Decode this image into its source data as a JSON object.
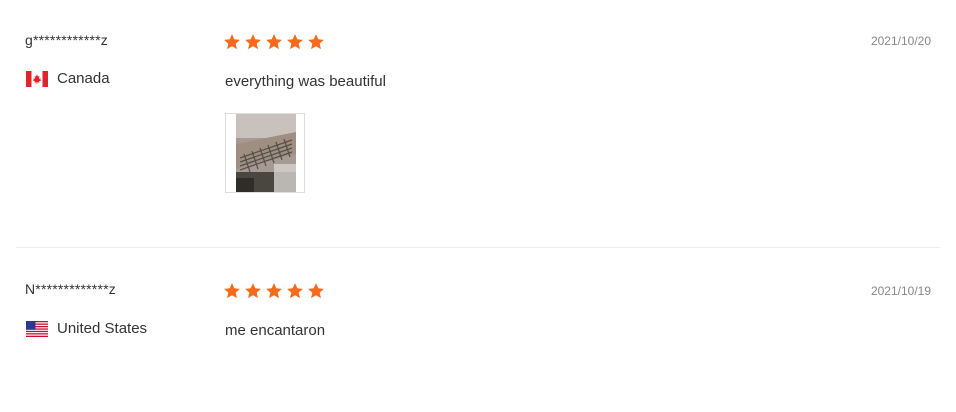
{
  "colors": {
    "star": "#f56a1b",
    "text": "#333333",
    "date": "#888888",
    "divider": "#eeeeee"
  },
  "reviews": [
    {
      "user": "g************z",
      "country": "Canada",
      "flag_icon": "canada-flag-icon",
      "rating": 5,
      "date": "2021/10/20",
      "comment": "everything was beautiful",
      "has_photo": true
    },
    {
      "user": "N*************z",
      "country": "United States",
      "flag_icon": "us-flag-icon",
      "rating": 5,
      "date": "2021/10/19",
      "comment": "me encantaron",
      "has_photo": false
    }
  ]
}
